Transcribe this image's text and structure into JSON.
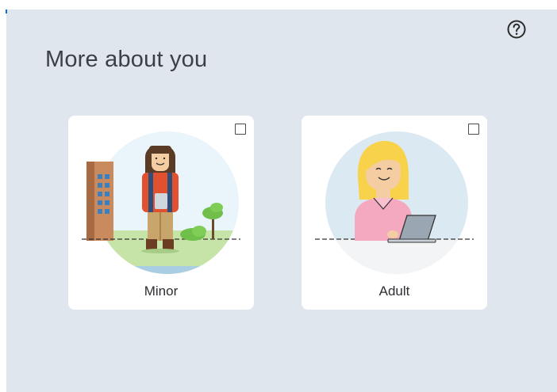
{
  "dialog": {
    "title": "More about you",
    "help_icon": "question-circle-icon"
  },
  "options": [
    {
      "label": "Minor",
      "checked": false,
      "illustration": "person-minor-illustration"
    },
    {
      "label": "Adult",
      "checked": false,
      "illustration": "person-adult-illustration"
    }
  ],
  "colors": {
    "panel_bg": "#dfe6ee",
    "card_bg": "#ffffff",
    "text": "#3c4046"
  }
}
